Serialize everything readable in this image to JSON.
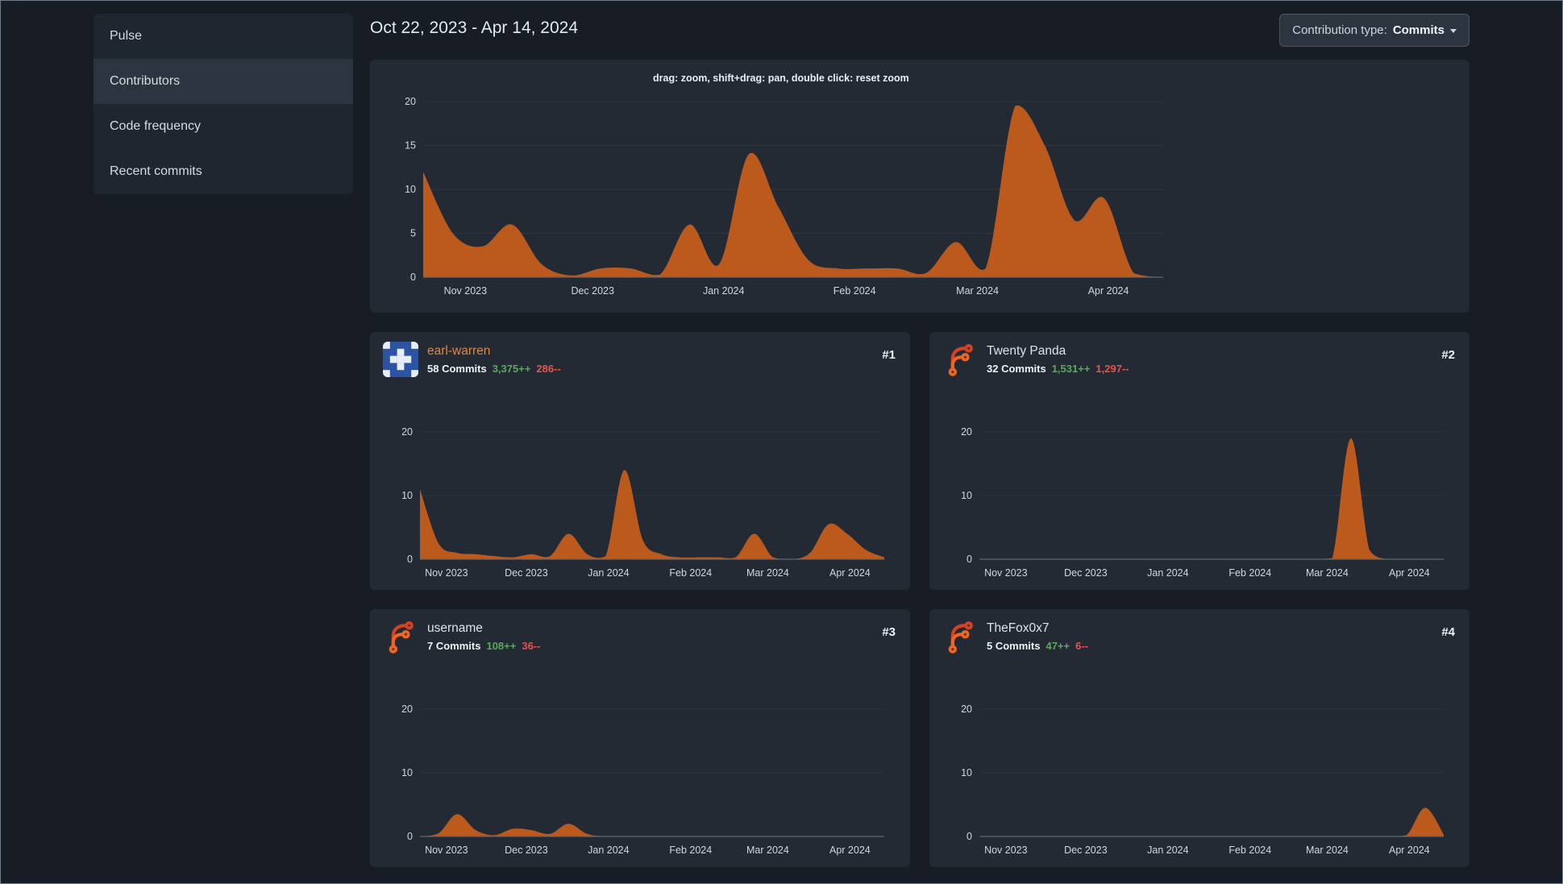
{
  "sidebar": {
    "items": [
      {
        "label": "Pulse"
      },
      {
        "label": "Contributors",
        "active": true
      },
      {
        "label": "Code frequency"
      },
      {
        "label": "Recent commits"
      }
    ]
  },
  "header": {
    "date_range": "Oct 22, 2023 - Apr 14, 2024",
    "contribution_type_label": "Contribution type:",
    "contribution_type_value": "Commits"
  },
  "main_chart": {
    "hint": "drag: zoom, shift+drag: pan, double click: reset zoom"
  },
  "colors": {
    "area_fill": "#bc5a1d",
    "grid_line": "#2f3743",
    "baseline": "#5c6673",
    "tick_label": "#cfd7e0",
    "additions": "#57ab5a",
    "deletions": "#e5534b"
  },
  "contributors": [
    {
      "rank": "#1",
      "name": "earl-warren",
      "name_color": "#e0883a",
      "avatar": "identicon",
      "commits": "58 Commits",
      "additions": "3,375++",
      "deletions": "286--"
    },
    {
      "rank": "#2",
      "name": "Twenty Panda",
      "name_color": "#dbe4ee",
      "avatar": "forgejo",
      "commits": "32 Commits",
      "additions": "1,531++",
      "deletions": "1,297--"
    },
    {
      "rank": "#3",
      "name": "username",
      "name_color": "#dbe4ee",
      "avatar": "forgejo",
      "commits": "7 Commits",
      "additions": "108++",
      "deletions": "36--"
    },
    {
      "rank": "#4",
      "name": "TheFox0x7",
      "name_color": "#dbe4ee",
      "avatar": "forgejo",
      "commits": "5 Commits",
      "additions": "47++",
      "deletions": "6--"
    }
  ],
  "chart_data": {
    "type": "area",
    "x_interval": "week",
    "x_range": "Oct 22, 2023 - Apr 14, 2024",
    "months": [
      "Nov 2023",
      "Dec 2023",
      "Jan 2024",
      "Feb 2024",
      "Mar 2024",
      "Apr 2024"
    ],
    "month_fractions": [
      0.057,
      0.229,
      0.406,
      0.583,
      0.749,
      0.926
    ],
    "ylim": [
      0,
      20
    ],
    "grid": true,
    "main": {
      "name": "all contributors (commits per week)",
      "yticks": [
        0,
        5,
        10,
        15,
        20
      ],
      "values": [
        12,
        5,
        3.5,
        6,
        1.5,
        0.2,
        1,
        1,
        0.3,
        6,
        1.5,
        14,
        8,
        2,
        1,
        1,
        1,
        0.5,
        4,
        1,
        19.5,
        15,
        6.5,
        9,
        0.5,
        0
      ]
    },
    "contributors": [
      {
        "name": "earl-warren",
        "yticks": [
          0,
          10,
          20
        ],
        "values": [
          11,
          2.5,
          1,
          0.8,
          0.5,
          0.3,
          0.8,
          0.5,
          4,
          0.8,
          0.5,
          14,
          3,
          0.8,
          0.3,
          0.3,
          0.3,
          0.3,
          4,
          0.3,
          0,
          1,
          5.5,
          4,
          1.5,
          0.3
        ]
      },
      {
        "name": "Twenty Panda",
        "yticks": [
          0,
          10,
          20
        ],
        "values": [
          0,
          0,
          0,
          0,
          0,
          0,
          0,
          0,
          0,
          0,
          0,
          0,
          0,
          0,
          0,
          0,
          0,
          0,
          0,
          0.2,
          19,
          1.5,
          0,
          0,
          0,
          0
        ]
      },
      {
        "name": "username",
        "yticks": [
          0,
          10,
          20
        ],
        "values": [
          0,
          0.5,
          3.5,
          1,
          0.2,
          1.2,
          1,
          0.4,
          2,
          0.4,
          0,
          0,
          0,
          0,
          0,
          0,
          0,
          0,
          0,
          0,
          0,
          0,
          0,
          0,
          0,
          0
        ]
      },
      {
        "name": "TheFox0x7",
        "yticks": [
          0,
          10,
          20
        ],
        "values": [
          0,
          0,
          0,
          0,
          0,
          0,
          0,
          0,
          0,
          0,
          0,
          0,
          0,
          0,
          0,
          0,
          0,
          0,
          0,
          0,
          0,
          0,
          0,
          0.2,
          4.5,
          0.3
        ]
      }
    ]
  }
}
